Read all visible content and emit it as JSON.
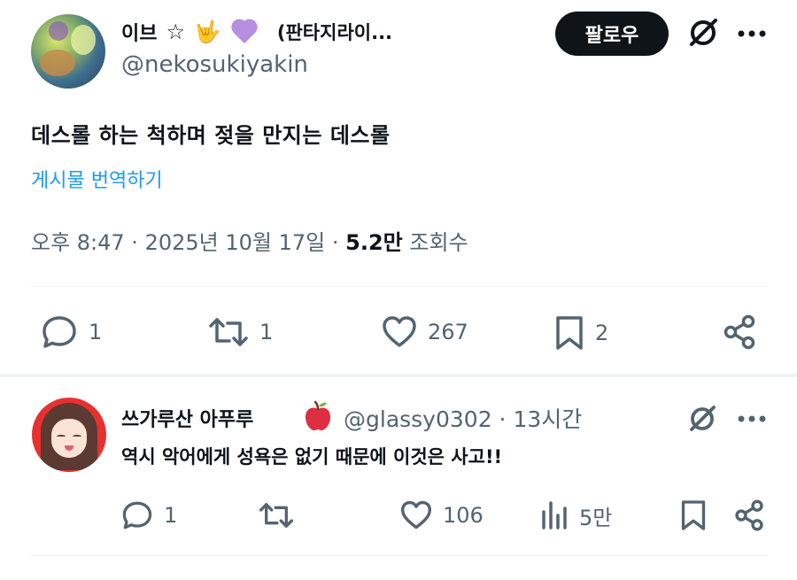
{
  "post": {
    "author": {
      "display_name": "이브",
      "name_suffix": "(판타지라이...",
      "emoji_star": "☆",
      "emoji_rock": "🤟",
      "handle": "@nekosukiyakin"
    },
    "follow_label": "팔로우",
    "text": "데스롤 하는 척하며 젖을 만지는 데스롤",
    "translate_label": "게시물 번역하기",
    "meta": {
      "time": "오후 8:47 · 2025년 10월 17일 · ",
      "views_count": "5.2만",
      "views_label": " 조회수"
    },
    "actions": {
      "reply_count": "1",
      "repost_count": "1",
      "like_count": "267",
      "bookmark_count": "2"
    }
  },
  "reply": {
    "display_name": "쓰가루산 아푸루",
    "handle_time": "@glassy0302 · 13시간",
    "text": "역시 악어에게 성욕은 없기 때문에 이것은 사고!!",
    "actions": {
      "reply_count": "1",
      "repost_count": "",
      "like_count": "106",
      "views_count": "5만"
    }
  },
  "colors": {
    "text": "#0f1419",
    "secondary": "#536471",
    "link": "#1d9bf0",
    "divider": "#eff3f4",
    "follow_bg": "#0f1419"
  }
}
